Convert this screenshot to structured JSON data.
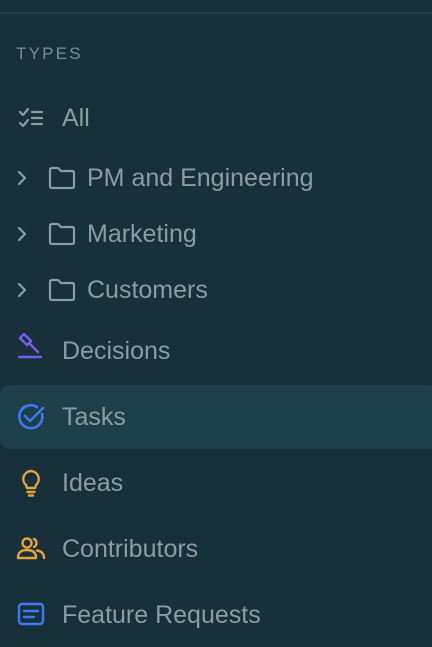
{
  "section": {
    "title": "TYPES"
  },
  "items": {
    "all": {
      "label": "All",
      "icon": "checklist-icon"
    },
    "pm": {
      "label": "PM and Engineering",
      "icon": "folder-icon"
    },
    "marketing": {
      "label": "Marketing",
      "icon": "folder-icon"
    },
    "customers": {
      "label": "Customers",
      "icon": "folder-icon"
    },
    "decisions": {
      "label": "Decisions",
      "icon": "gavel-icon",
      "color": "#7b5cf0"
    },
    "tasks": {
      "label": "Tasks",
      "icon": "check-circle-icon",
      "color": "#3d7cf0",
      "selected": true
    },
    "ideas": {
      "label": "Ideas",
      "icon": "lightbulb-icon",
      "color": "#e8a23a"
    },
    "contributors": {
      "label": "Contributors",
      "icon": "people-icon",
      "color": "#e8a23a"
    },
    "feature_requests": {
      "label": "Feature Requests",
      "icon": "message-box-icon",
      "color": "#3d7cf0"
    }
  }
}
